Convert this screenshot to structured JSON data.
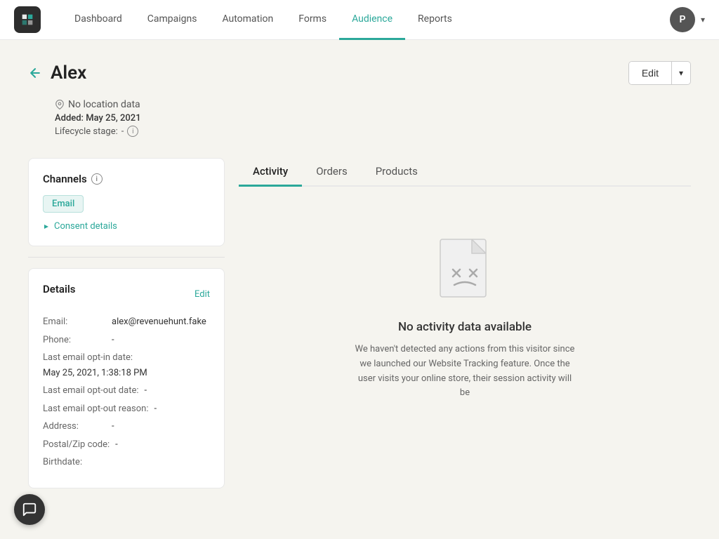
{
  "nav": {
    "links": [
      {
        "id": "dashboard",
        "label": "Dashboard",
        "active": false
      },
      {
        "id": "campaigns",
        "label": "Campaigns",
        "active": false
      },
      {
        "id": "automation",
        "label": "Automation",
        "active": false
      },
      {
        "id": "forms",
        "label": "Forms",
        "active": false
      },
      {
        "id": "audience",
        "label": "Audience",
        "active": true
      },
      {
        "id": "reports",
        "label": "Reports",
        "active": false
      }
    ],
    "avatar_initial": "P"
  },
  "page": {
    "title": "Alex",
    "edit_button": "Edit",
    "location": "No location data",
    "added_label": "Added:",
    "added_date": "May 25, 2021",
    "lifecycle_label": "Lifecycle stage:",
    "lifecycle_value": "-"
  },
  "channels_card": {
    "title": "Channels",
    "badge": "Email",
    "consent_label": "Consent details"
  },
  "details_card": {
    "title": "Details",
    "edit_label": "Edit",
    "rows": [
      {
        "label": "Email:",
        "value": "alex@revenuehunt.fake"
      },
      {
        "label": "Phone:",
        "value": "-"
      },
      {
        "label": "Last email opt-in date:",
        "value": "May 25, 2021, 1:38:18 PM"
      },
      {
        "label": "Last email opt-out date:",
        "value": "-"
      },
      {
        "label": "Last email opt-out reason:",
        "value": "-"
      },
      {
        "label": "Address:",
        "value": "-"
      },
      {
        "label": "Postal/Zip code:",
        "value": "-"
      },
      {
        "label": "Birthdate:",
        "value": ""
      }
    ]
  },
  "tabs": [
    {
      "id": "activity",
      "label": "Activity",
      "active": true
    },
    {
      "id": "orders",
      "label": "Orders",
      "active": false
    },
    {
      "id": "products",
      "label": "Products",
      "active": false
    }
  ],
  "empty_state": {
    "title": "No activity data available",
    "description": "We haven't detected any actions from this visitor since we launched our Website Tracking feature. Once the user visits your online store, their session activity will be"
  }
}
